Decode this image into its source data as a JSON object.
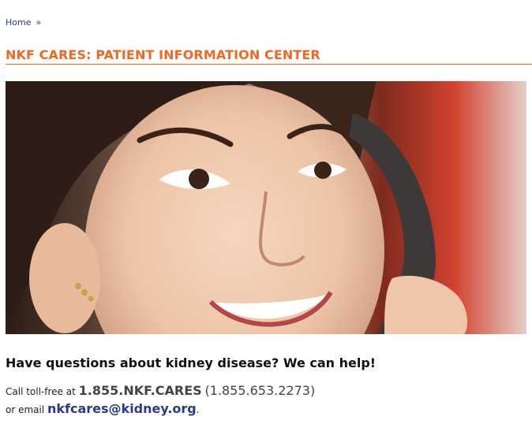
{
  "breadcrumb": {
    "home_label": "Home",
    "separator": "»"
  },
  "page": {
    "title": "NKF CARES: PATIENT INFORMATION CENTER"
  },
  "hero": {
    "image_subject": "woman-on-phone-photo"
  },
  "content": {
    "question": "Have questions about kidney disease? We can help!",
    "call_prefix": "Call toll-free at",
    "phone_vanity": "1.855.NKF.CARES",
    "phone_number": "(1.855.653.2273)",
    "email_prefix": "or email",
    "email": "nkfcares@kidney.org",
    "email_suffix": "."
  },
  "colors": {
    "accent": "#f26722",
    "link": "#2b3a8c"
  }
}
